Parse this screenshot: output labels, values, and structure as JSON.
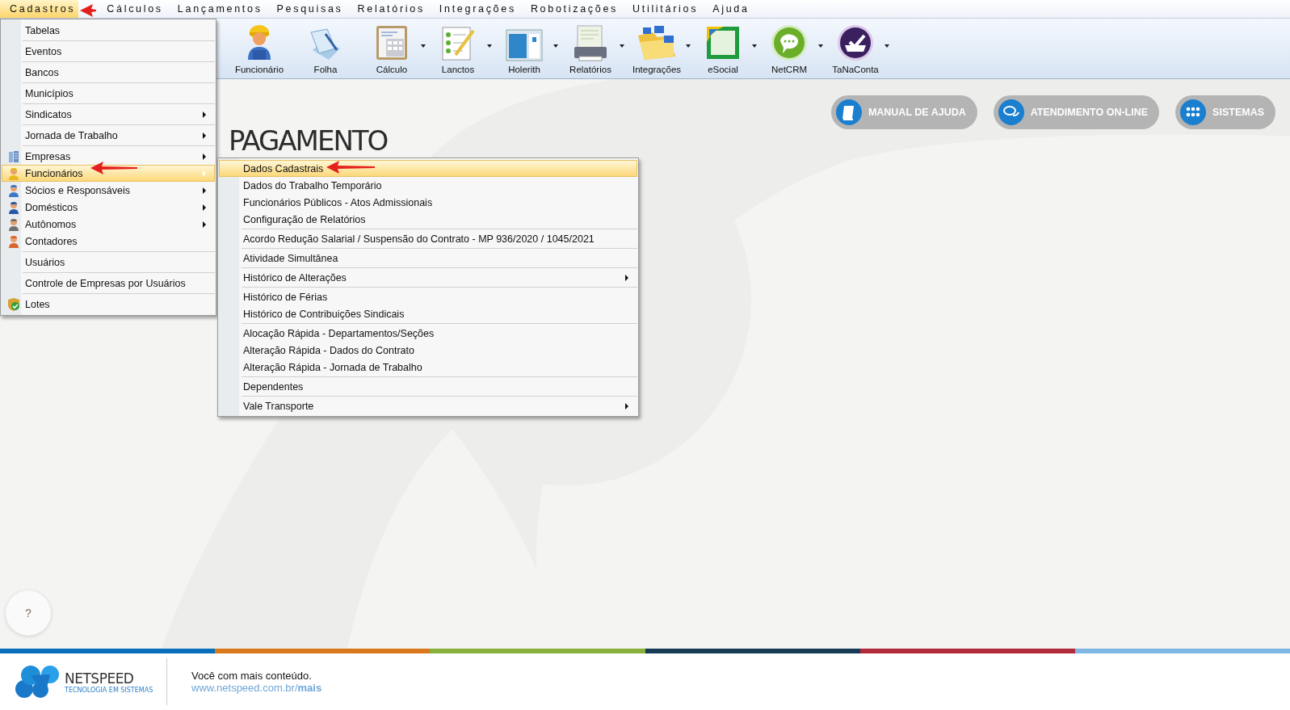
{
  "menubar": [
    {
      "label": "Cadastros",
      "selected": true
    },
    {
      "label": "Cálculos",
      "selected": false
    },
    {
      "label": "Lançamentos",
      "selected": false
    },
    {
      "label": "Pesquisas",
      "selected": false
    },
    {
      "label": "Relatórios",
      "selected": false
    },
    {
      "label": "Integrações",
      "selected": false
    },
    {
      "label": "Robotizações",
      "selected": false
    },
    {
      "label": "Utilitários",
      "selected": false
    },
    {
      "label": "Ajuda",
      "selected": false
    }
  ],
  "toolbar": [
    {
      "label": "Funcionário",
      "dropdown": false
    },
    {
      "label": "Folha",
      "dropdown": false
    },
    {
      "label": "Cálculo",
      "dropdown": true
    },
    {
      "label": "Lanctos",
      "dropdown": true
    },
    {
      "label": "Holerith",
      "dropdown": true
    },
    {
      "label": "Relatórios",
      "dropdown": true
    },
    {
      "label": "Integrações",
      "dropdown": true
    },
    {
      "label": "eSocial",
      "dropdown": true
    },
    {
      "label": "NetCRM",
      "dropdown": true
    },
    {
      "label": "TaNaConta",
      "dropdown": true
    }
  ],
  "quick_buttons": [
    "MANUAL DE AJUDA",
    "ATENDIMENTO ON-LINE",
    "SISTEMAS"
  ],
  "product_logo": "PAGAMENTO",
  "help_button": "?",
  "cadastros_menu": {
    "groups": [
      [
        {
          "label": "Tabelas",
          "kind": "plain",
          "submenu": false,
          "selected": false
        }
      ],
      [
        {
          "label": "Eventos",
          "kind": "plain",
          "submenu": false,
          "selected": false
        }
      ],
      [
        {
          "label": "Bancos",
          "kind": "plain",
          "submenu": false,
          "selected": false
        }
      ],
      [
        {
          "label": "Municípios",
          "kind": "plain",
          "submenu": false,
          "selected": false
        }
      ],
      [
        {
          "label": "Sindicatos",
          "kind": "plain",
          "submenu": true,
          "selected": false
        }
      ],
      [
        {
          "label": "Jornada de Trabalho",
          "kind": "plain",
          "submenu": true,
          "selected": false
        }
      ],
      [
        {
          "label": "Empresas",
          "kind": "building",
          "submenu": true,
          "selected": false
        },
        {
          "label": "Funcionários",
          "kind": "person",
          "color": "#e8b820",
          "submenu": true,
          "selected": true
        },
        {
          "label": "Sócios e Responsáveis",
          "kind": "person",
          "color": "#3a78c8",
          "submenu": true,
          "selected": false
        },
        {
          "label": "Domésticos",
          "kind": "person",
          "color": "#2a58a8",
          "submenu": true,
          "selected": false
        },
        {
          "label": "Autônomos",
          "kind": "person",
          "color": "#707070",
          "submenu": true,
          "selected": false
        },
        {
          "label": "Contadores",
          "kind": "person",
          "color": "#d8662a",
          "submenu": false,
          "selected": false
        }
      ],
      [
        {
          "label": "Usuários",
          "kind": "plain",
          "submenu": false,
          "selected": false
        }
      ],
      [
        {
          "label": "Controle de Empresas por Usuários",
          "kind": "plain",
          "submenu": false,
          "selected": false
        }
      ],
      [
        {
          "label": "Lotes",
          "kind": "shield",
          "submenu": false,
          "selected": false
        }
      ]
    ]
  },
  "funcionarios_menu": {
    "groups": [
      [
        {
          "label": "Dados Cadastrais",
          "submenu": false,
          "selected": true
        },
        {
          "label": "Dados do Trabalho Temporário",
          "submenu": false,
          "selected": false
        },
        {
          "label": "Funcionários Públicos - Atos Admissionais",
          "submenu": false,
          "selected": false
        },
        {
          "label": "Configuração de Relatórios",
          "submenu": false,
          "selected": false
        }
      ],
      [
        {
          "label": "Acordo Redução Salarial / Suspensão do Contrato - MP 936/2020 / 1045/2021",
          "submenu": false,
          "selected": false
        }
      ],
      [
        {
          "label": "Atividade Simultânea",
          "submenu": false,
          "selected": false
        }
      ],
      [
        {
          "label": "Histórico de Alterações",
          "submenu": true,
          "selected": false
        }
      ],
      [
        {
          "label": "Histórico de Férias",
          "submenu": false,
          "selected": false
        },
        {
          "label": "Histórico de Contribuições Sindicais",
          "submenu": false,
          "selected": false
        }
      ],
      [
        {
          "label": "Alocação Rápida - Departamentos/Seções",
          "submenu": false,
          "selected": false
        },
        {
          "label": "Alteração Rápida - Dados do Contrato",
          "submenu": false,
          "selected": false
        },
        {
          "label": "Alteração Rápida - Jornada de Trabalho",
          "submenu": false,
          "selected": false
        }
      ],
      [
        {
          "label": "Dependentes",
          "submenu": false,
          "selected": false
        }
      ],
      [
        {
          "label": "Vale Transporte",
          "submenu": true,
          "selected": false
        }
      ]
    ]
  },
  "footer": {
    "brand": "NETSPEED",
    "brand_tagline": "TECNOLOGIA EM SISTEMAS",
    "message": "Você com mais conteúdo.",
    "link": "www.netspeed.com.br/**mais**"
  }
}
